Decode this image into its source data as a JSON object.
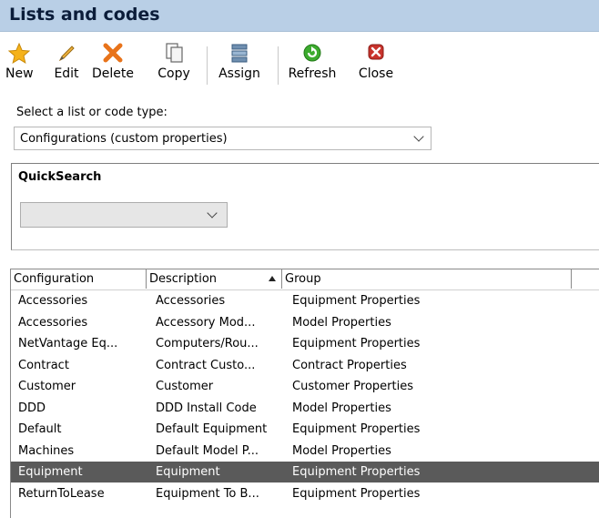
{
  "window": {
    "title": "Lists and codes"
  },
  "toolbar": {
    "buttons": [
      {
        "label": "New",
        "icon": "star-icon"
      },
      {
        "label": "Edit",
        "icon": "pencil-icon"
      },
      {
        "label": "Delete",
        "icon": "delete-x-icon"
      },
      {
        "label": "Copy",
        "icon": "copy-icon"
      },
      {
        "label": "Assign",
        "icon": "assign-icon"
      },
      {
        "label": "Refresh",
        "icon": "refresh-icon"
      },
      {
        "label": "Close",
        "icon": "close-icon"
      }
    ]
  },
  "selector": {
    "label": "Select a list or code type:",
    "value": "Configurations (custom properties)"
  },
  "quicksearch": {
    "title": "QuickSearch",
    "value": ""
  },
  "grid": {
    "columns": [
      "Configuration",
      "Description",
      "Group"
    ],
    "sorted_column": "Description",
    "selected_row": 8,
    "rows": [
      [
        "Accessories",
        "Accessories",
        "Equipment Properties"
      ],
      [
        "Accessories",
        "Accessory Mod...",
        "Model Properties"
      ],
      [
        "NetVantage Eq...",
        "Computers/Rou...",
        "Equipment Properties"
      ],
      [
        "Contract",
        "Contract Custo...",
        "Contract Properties"
      ],
      [
        "Customer",
        "Customer",
        "Customer Properties"
      ],
      [
        "DDD",
        "DDD Install Code",
        "Model Properties"
      ],
      [
        "Default",
        "Default Equipment",
        "Equipment Properties"
      ],
      [
        "Machines",
        "Default Model P...",
        "Model Properties"
      ],
      [
        "Equipment",
        "Equipment",
        "Equipment Properties"
      ],
      [
        "ReturnToLease",
        "Equipment To B...",
        "Equipment Properties"
      ]
    ]
  },
  "colors": {
    "titlebar": "#b9cfe6",
    "selected_row": "#5a5a5a",
    "star": "#f5b21a",
    "delete": "#e8731a",
    "refresh": "#3cab2e",
    "close": "#c8332c"
  }
}
